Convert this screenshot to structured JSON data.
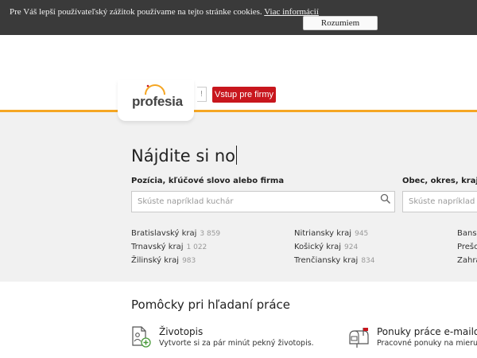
{
  "cookie_bar": {
    "text": "Pre Váš lepší používateľský zážitok používame na tejto stránke cookies.",
    "link": "Viac informácií",
    "button": "Rozumiem"
  },
  "header": {
    "logo": "profesia",
    "gray_button": "!",
    "red_button": "Vstup pre firmy"
  },
  "search": {
    "headline": "Nájdite si no",
    "position_label": "Pozícia, kľúčové slovo alebo firma",
    "position_placeholder": "Skúste napríklad kuchár",
    "location_label": "Obec, okres, kraj ale",
    "location_placeholder": "Skúste napríklad Br"
  },
  "regions": [
    {
      "name": "Bratislavský kraj",
      "count": "3 859"
    },
    {
      "name": "Trnavský kraj",
      "count": "1 022"
    },
    {
      "name": "Žilinský kraj",
      "count": "983"
    },
    {
      "name": "Nitriansky kraj",
      "count": "945"
    },
    {
      "name": "Košický kraj",
      "count": "924"
    },
    {
      "name": "Trenčiansky kraj",
      "count": "834"
    },
    {
      "name": "Bansk",
      "count": ""
    },
    {
      "name": "Prešo",
      "count": ""
    },
    {
      "name": "Zahra",
      "count": ""
    }
  ],
  "tools": {
    "title": "Pomôcky pri hľadaní práce",
    "items": [
      {
        "title": "Životopis",
        "desc": "Vytvorte si za pár minút pekný životopis.",
        "icon": "cv-add-icon"
      },
      {
        "title": "Ponuky práce e-mailom",
        "desc": "Pracovné ponuky na mieru e-m",
        "icon": "mailbox-icon"
      }
    ]
  },
  "colors": {
    "accent_orange": "#f5a623",
    "brand_red": "#c8161d",
    "cookie_bg": "#3a3a3a",
    "section_bg": "#f1f1f1"
  }
}
